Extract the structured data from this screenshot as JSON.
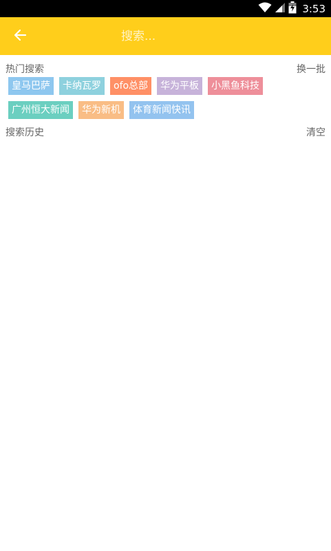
{
  "status_bar": {
    "time": "3:53",
    "icons": [
      "wifi-icon",
      "signal-icon",
      "battery-icon"
    ]
  },
  "toolbar": {
    "back_icon": "arrow-left-icon",
    "search_placeholder": "搜索...",
    "background_color": "#FFCE1B"
  },
  "hot_search": {
    "title": "热门搜索",
    "action": "换一批",
    "tags": [
      {
        "label": "皇马巴萨",
        "color": "#8EC7EF"
      },
      {
        "label": "卡纳瓦罗",
        "color": "#8ED1DE"
      },
      {
        "label": "ofo总部",
        "color": "#FF9066"
      },
      {
        "label": "华为平板",
        "color": "#C7B3DA"
      },
      {
        "label": "小黑鱼科技",
        "color": "#EE8F9A"
      },
      {
        "label": "广州恒大新闻",
        "color": "#6BCFC0"
      },
      {
        "label": "华为新机",
        "color": "#F9BD85"
      },
      {
        "label": "体育新闻快讯",
        "color": "#93C3EF"
      }
    ]
  },
  "history": {
    "title": "搜索历史",
    "action": "清空"
  }
}
